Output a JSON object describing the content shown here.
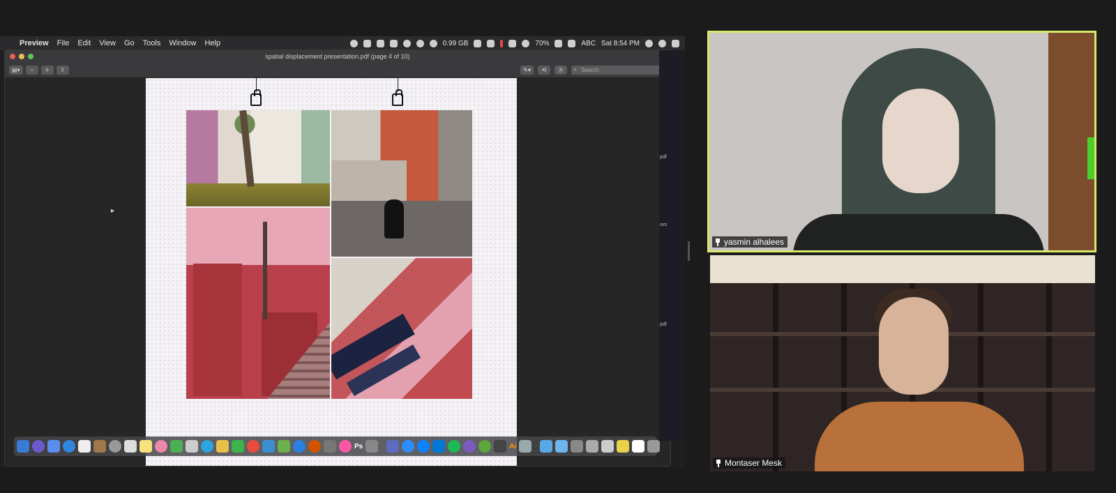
{
  "menubar": {
    "apple_icon": "apple-logo-icon",
    "app": "Preview",
    "items": [
      "File",
      "Edit",
      "View",
      "Go",
      "Tools",
      "Window",
      "Help"
    ],
    "memory": "0.99 GB",
    "battery": "70%",
    "input_source": "ABC",
    "clock": "Sat 8:54 PM"
  },
  "window": {
    "title": "spatial displacement presentation.pdf (page 4 of 10)",
    "search_placeholder": "Search"
  },
  "participants": [
    {
      "name": "yasmin alhalees",
      "active_speaker": true,
      "border_color": "#d8e86a"
    },
    {
      "name": "Montaser Mesk",
      "active_speaker": false
    }
  ],
  "sliver": {
    "label_1": "pdf",
    "label_2": "sxs",
    "label_3": "pdf"
  },
  "dock": {
    "ps_label": "Ps",
    "ai_label": "Ai"
  },
  "colors": {
    "active_speaker": "#d8e86a",
    "menubar": "#2b2b2d"
  }
}
